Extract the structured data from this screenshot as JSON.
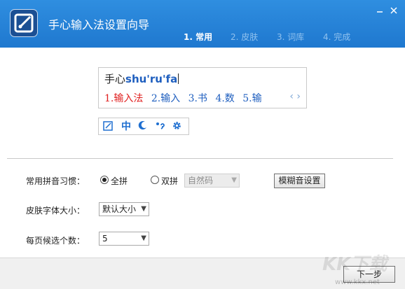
{
  "window": {
    "title": "手心输入法设置向导",
    "icons": {
      "app": "app-logo-icon",
      "minimize": "minimize-icon",
      "close": "close-icon"
    },
    "colors": {
      "header": "#2284d6",
      "step_inactive": "#8fc1ee",
      "step_active": "#ffffff"
    }
  },
  "steps": [
    {
      "label": "1. 常用",
      "active": true
    },
    {
      "label": "2. 皮肤",
      "active": false
    },
    {
      "label": "3. 词库",
      "active": false
    },
    {
      "label": "4. 完成",
      "active": false
    }
  ],
  "preview": {
    "composition_han": "手心",
    "composition_pinyin": "shu'ru'fa",
    "candidates": [
      "1.输入法",
      "2.输入",
      "3.书",
      "4.数",
      "5.输"
    ],
    "page_arrows": "‹ ›",
    "colors": {
      "first_candidate": "#e02020",
      "candidate": "#1f5fbf"
    }
  },
  "toolbar": {
    "buttons": [
      {
        "icon": "pen-box-icon"
      },
      {
        "icon": "chinese-mode-icon",
        "glyph": "中"
      },
      {
        "icon": "moon-icon"
      },
      {
        "icon": "punctuation-icon"
      },
      {
        "icon": "gear-icon"
      }
    ]
  },
  "settings": {
    "pinyin_habit": {
      "label": "常用拼音习惯：",
      "full_pinyin": "全拼",
      "double_pinyin": "双拼",
      "selected": "全拼",
      "double_scheme": "自然码",
      "fuzzy_button": "模糊音设置"
    },
    "skin_font_size": {
      "label": "皮肤字体大小：",
      "value": "默认大小"
    },
    "candidates_per_page": {
      "label": "每页候选个数：",
      "value": "5"
    }
  },
  "footer": {
    "next_button": "下一步"
  },
  "watermark": {
    "text": "KK下载",
    "url": "www.kkx.net"
  }
}
